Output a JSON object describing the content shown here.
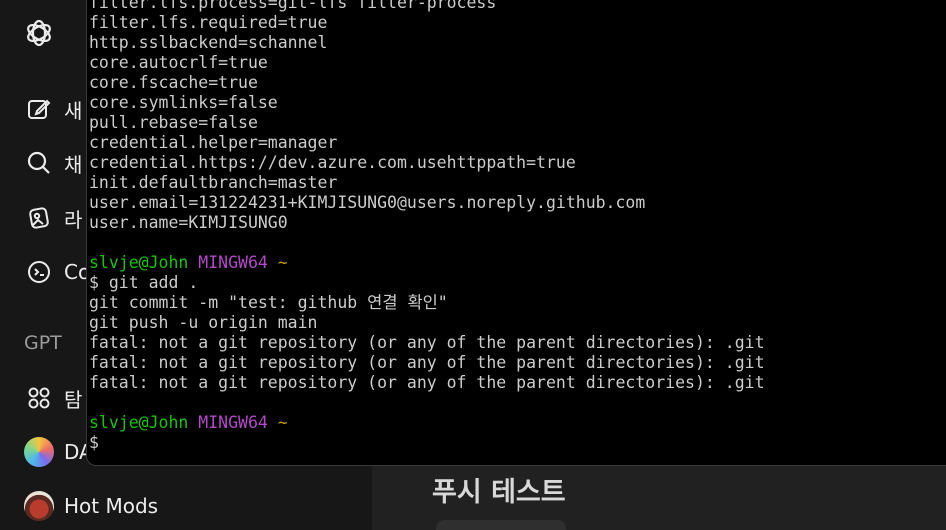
{
  "sidebar": {
    "items": [
      {
        "id": "new-chat",
        "label": "새",
        "icon": "edit-icon"
      },
      {
        "id": "search",
        "label": "채",
        "icon": "search-icon"
      },
      {
        "id": "library",
        "label": "라",
        "icon": "library-icon"
      },
      {
        "id": "codex",
        "label": "Co",
        "icon": "codex-icon"
      }
    ],
    "gpt_section_label": "GPT",
    "gpts": [
      {
        "id": "explore",
        "label": "탐",
        "icon": "grid-dots-icon"
      },
      {
        "id": "dalle",
        "label": "DA",
        "icon": "dalle-avatar"
      },
      {
        "id": "hot-mods",
        "label": "Hot Mods",
        "icon": "hot-mods-avatar"
      }
    ]
  },
  "main": {
    "heading": "푸시 테스트"
  },
  "terminal": {
    "config_lines": [
      "filter.lfs.process=git-lfs filter-process",
      "filter.lfs.required=true",
      "http.sslbackend=schannel",
      "core.autocrlf=true",
      "core.fscache=true",
      "core.symlinks=false",
      "pull.rebase=false",
      "credential.helper=manager",
      "credential.https://dev.azure.com.usehttppath=true",
      "init.defaultbranch=master",
      "user.email=131224231+KIMJISUNG0@users.noreply.github.com",
      "user.name=KIMJISUNG0"
    ],
    "prompt1": {
      "user": "slvje@John",
      "env": "MINGW64",
      "dir": "~"
    },
    "commands": [
      "$ git add .",
      "git commit -m \"test: github 연결 확인\"",
      "git push -u origin main"
    ],
    "errors": [
      "fatal: not a git repository (or any of the parent directories): .git",
      "fatal: not a git repository (or any of the parent directories): .git",
      "fatal: not a git repository (or any of the parent directories): .git"
    ],
    "prompt2": {
      "user": "slvje@John",
      "env": "MINGW64",
      "dir": "~"
    },
    "input_prefix": "$"
  }
}
